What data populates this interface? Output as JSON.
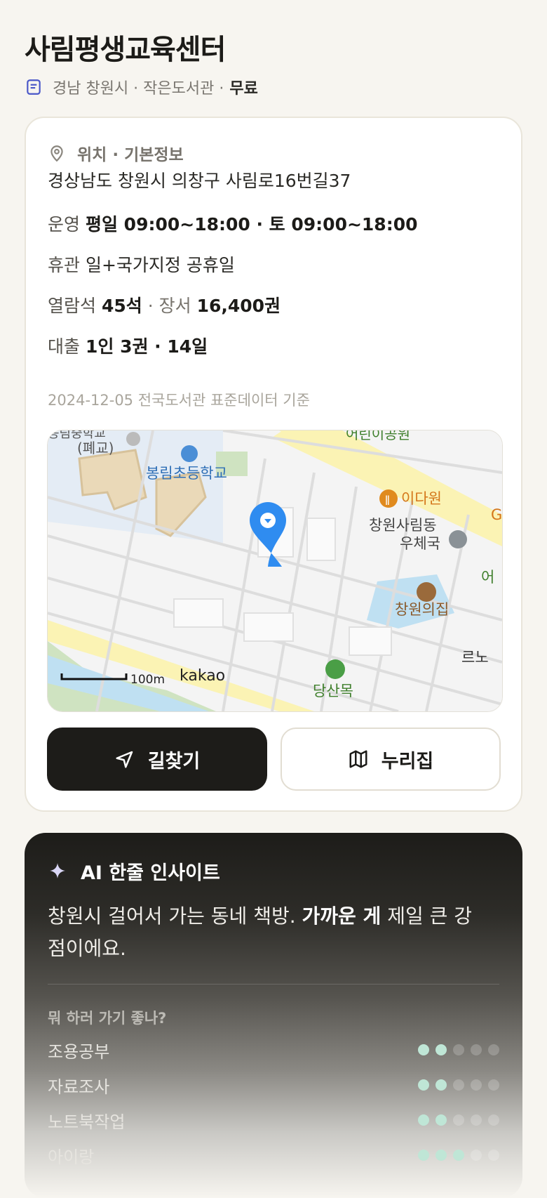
{
  "header": {
    "title": "사림평생교육센터",
    "region": "경남 창원시 · 작은도서관 ·",
    "fee": "무료"
  },
  "info": {
    "section_title": "위치 · 기본정보",
    "address": "경상남도 창원시 의창구 사림로16번길37",
    "hours_label": "운영",
    "hours_value": "평일 09:00~18:00 · 토 09:00~18:00",
    "closed_label": "휴관",
    "closed_value": "일+국가지정 공휴일",
    "seats_label": "열람석",
    "seats_value": "45석",
    "books_label": "· 장서",
    "books_value": "16,400권",
    "loan_label": "대출",
    "loan_value": "1인 3권 · 14일",
    "data_basis": "2024-12-05 전국도서관 표준데이터 기준"
  },
  "map": {
    "labels": {
      "school_closed_top": "동림중학교",
      "school_closed": "(폐교)",
      "elementary": "봉림초등학교",
      "park_top": "어린이공원",
      "restaurant": "이다원",
      "post_office_1": "창원사림동",
      "post_office_2": "우체국",
      "house": "창원의집",
      "right_edge": "어",
      "right_edge_2": "르노",
      "bottom_poi": "당산목",
      "scale": "100m",
      "provider": "kakao",
      "orange_edge": "G"
    },
    "colors": {
      "marker": "#2f8cf0",
      "road_major": "#fbf3b4",
      "water": "#bfe0f2",
      "school_zone": "#e4ecf5",
      "building": "#ead9b8",
      "park": "#cfe3c1"
    }
  },
  "buttons": {
    "directions": "길찾기",
    "website": "누리집"
  },
  "ai": {
    "title": "AI 한줄 인사이트",
    "summary_pre": "창원시 걸어서 가는 동네 책방. ",
    "summary_bold": "가까운 게",
    "summary_post": " 제일 큰 강점이에요.",
    "question": "뭐 하러 가기 좋나?",
    "activities": [
      {
        "label": "조용공부",
        "score": 2,
        "max": 5
      },
      {
        "label": "자료조사",
        "score": 2,
        "max": 5
      },
      {
        "label": "노트북작업",
        "score": 2,
        "max": 5
      },
      {
        "label": "아이랑",
        "score": 3,
        "max": 5
      }
    ]
  }
}
